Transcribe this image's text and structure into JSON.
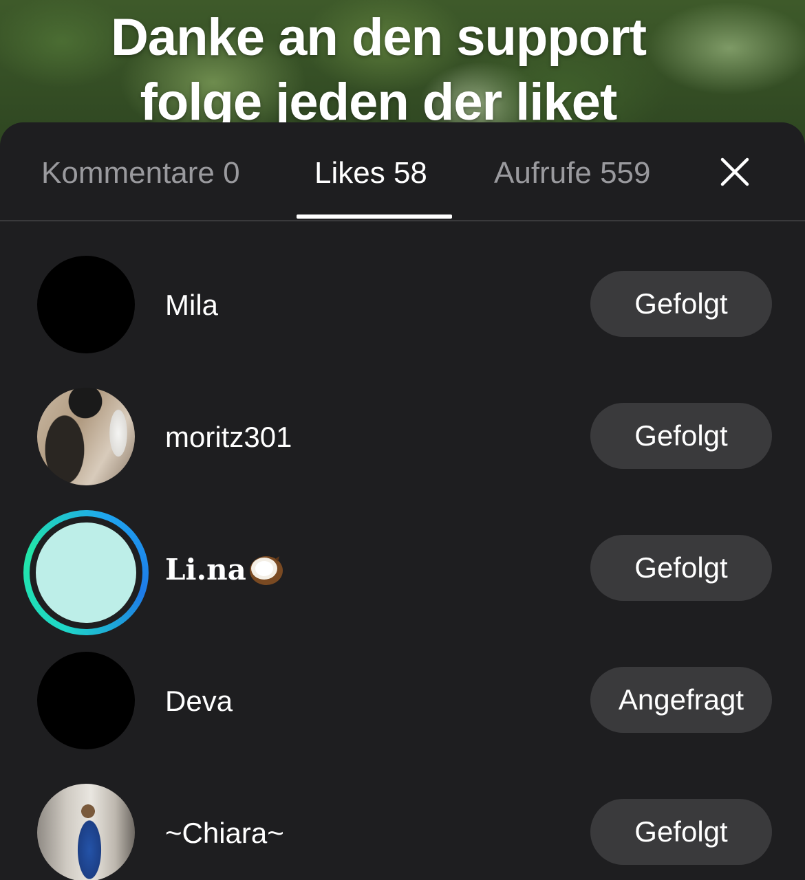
{
  "video": {
    "caption_line1": "Danke an den support",
    "caption_line2": "folge jeden der liket"
  },
  "tabs": [
    {
      "label": "Kommentare 0",
      "active": false
    },
    {
      "label": "Likes 58",
      "active": true
    },
    {
      "label": "Aufrufe 559",
      "active": false
    }
  ],
  "close_icon": "close-icon",
  "users": [
    {
      "name": "Mila",
      "avatar": "black",
      "button": "Gefolgt"
    },
    {
      "name": "moritz301",
      "avatar": "photo",
      "button": "Gefolgt"
    },
    {
      "name": "Li.na",
      "emoji_icon": "coconut-icon",
      "avatar": "story-ring",
      "button": "Gefolgt"
    },
    {
      "name": "Deva",
      "avatar": "black",
      "button": "Angefragt"
    },
    {
      "name": "~Chiara~",
      "avatar": "photo",
      "button": "Gefolgt"
    }
  ],
  "colors": {
    "sheet_bg": "#1e1e20",
    "button_bg": "#3a3a3c",
    "inactive_tab": "#9a9a9e",
    "story_ring": "#1fd7c8"
  }
}
